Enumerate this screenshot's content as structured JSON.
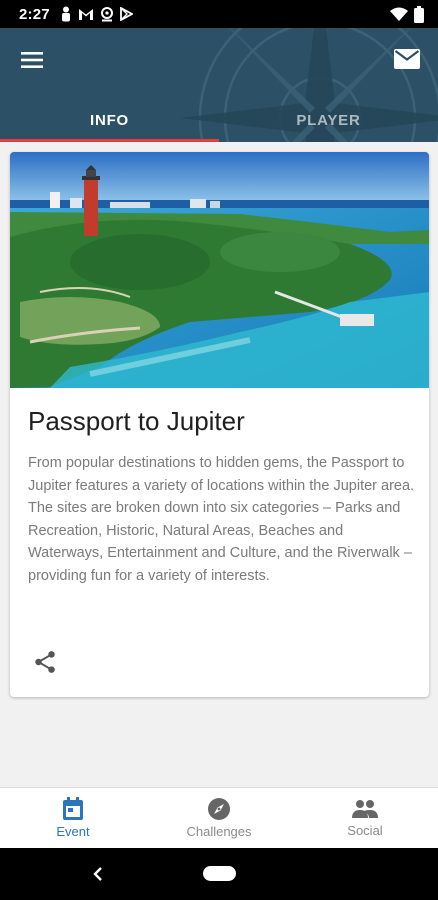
{
  "status_bar": {
    "time": "2:27",
    "left_icons": [
      "person-icon",
      "gmail-icon",
      "location-icon",
      "play-store-icon"
    ],
    "right_icons": [
      "wifi-icon",
      "battery-icon"
    ]
  },
  "header": {
    "menu_icon": "menu-icon",
    "mail_icon": "mail-icon",
    "tabs": [
      {
        "label": "INFO",
        "active": true
      },
      {
        "label": "PLAYER",
        "active": false
      }
    ],
    "colors": {
      "background": "#2c5166",
      "indicator": "#e53b3b"
    }
  },
  "card": {
    "image": "aerial view of lighthouse and waterway",
    "title": "Passport to Jupiter",
    "description": "From popular destinations to hidden gems, the Passport to Jupiter features a variety of locations within the Jupiter area. The sites are broken down into six categories – Parks and Recreation, Historic, Natural Areas, Beaches and Waterways, Entertainment and Culture, and the Riverwalk – providing fun for a variety of interests.",
    "share_icon": "share-icon"
  },
  "bottom_nav": {
    "items": [
      {
        "label": "Event",
        "icon": "calendar-icon",
        "active": true
      },
      {
        "label": "Challenges",
        "icon": "compass-icon",
        "active": false
      },
      {
        "label": "Social",
        "icon": "people-icon",
        "active": false
      }
    ],
    "colors": {
      "active": "#2b76b9",
      "inactive": "#8a8a8a"
    }
  }
}
